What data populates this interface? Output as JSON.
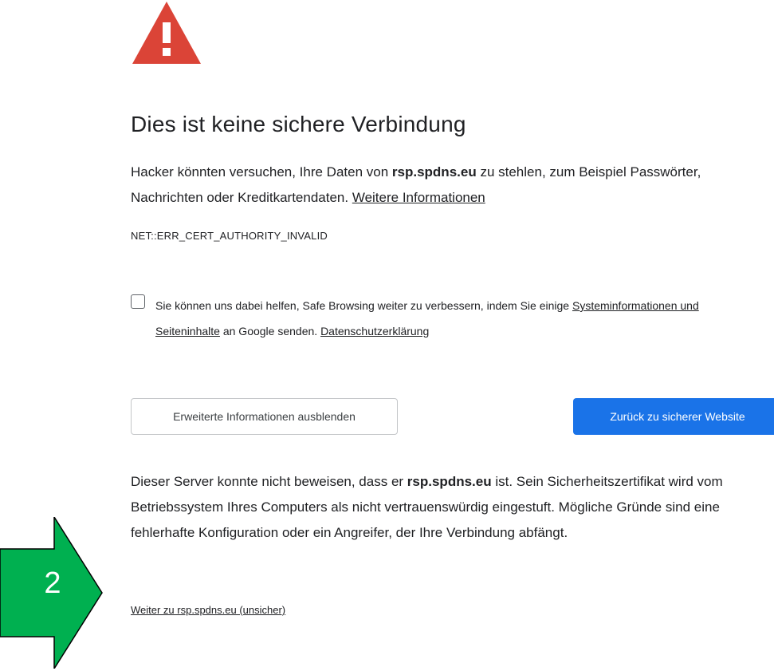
{
  "warning": {
    "icon": "warning-triangle-icon",
    "color": "#db4437"
  },
  "title": "Dies ist keine sichere Verbindung",
  "summary": {
    "part1": "Hacker könnten versuchen, Ihre Daten von ",
    "host": "rsp.spdns.eu",
    "part2": " zu stehlen, zum Beispiel Passwörter, Nachrichten oder Kreditkartendaten. ",
    "learn_more": "Weitere Informationen"
  },
  "error_code": "NET::ERR_CERT_AUTHORITY_INVALID",
  "safe_browsing": {
    "checked": false,
    "part1": "Sie können uns dabei helfen, Safe Browsing weiter zu verbessern, indem Sie einige ",
    "link1": "Systeminformationen und Seiteninhalte",
    "part2": " an Google senden. ",
    "link2": "Datenschutzerklärung"
  },
  "buttons": {
    "details_label": "Erweiterte Informationen ausblenden",
    "back_label": "Zurück zu sicherer Website",
    "primary_color": "#1a73e8"
  },
  "details": {
    "part1": "Dieser Server konnte nicht beweisen, dass er ",
    "host": "rsp.spdns.eu",
    "part2": " ist. Sein Sicherheitszertifikat wird vom Betriebssystem Ihres Computers als nicht vertrauenswürdig eingestuft. Mögliche Gründe sind eine fehlerhafte Konfiguration oder ein Angreifer, der Ihre Verbindung abfängt."
  },
  "proceed_link": "Weiter zu rsp.spdns.eu (unsicher)",
  "annotation": {
    "step": "2",
    "arrow_color": "#00b050"
  }
}
